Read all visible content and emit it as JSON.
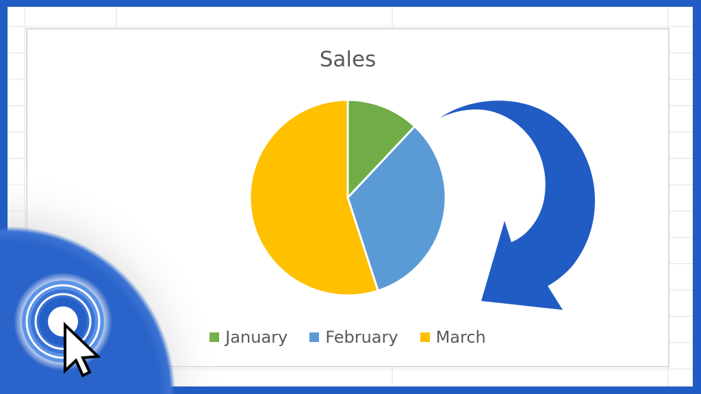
{
  "frame": {
    "accent_color": "#215cc4"
  },
  "chart_data": {
    "type": "pie",
    "title": "Sales",
    "categories": [
      "January",
      "February",
      "March"
    ],
    "values": [
      12,
      33,
      55
    ],
    "unit": "percent (estimated from slice angles)",
    "colors": [
      "#70ad47",
      "#5b9bd5",
      "#ffc000"
    ],
    "start_angle_deg": 0,
    "direction": "clockwise",
    "legend_position": "bottom",
    "slice_border_color": "#ffffff"
  },
  "legend": {
    "items": [
      {
        "label": "January",
        "color": "#70ad47"
      },
      {
        "label": "February",
        "color": "#5b9bd5"
      },
      {
        "label": "March",
        "color": "#ffc000"
      }
    ]
  },
  "decorations": {
    "curved_arrow": {
      "icon": "rotate-clockwise-arrow-icon",
      "color": "#215cc4"
    },
    "click_indicator": {
      "icon": "mouse-click-cursor-icon",
      "color": "#2a63c9"
    }
  }
}
